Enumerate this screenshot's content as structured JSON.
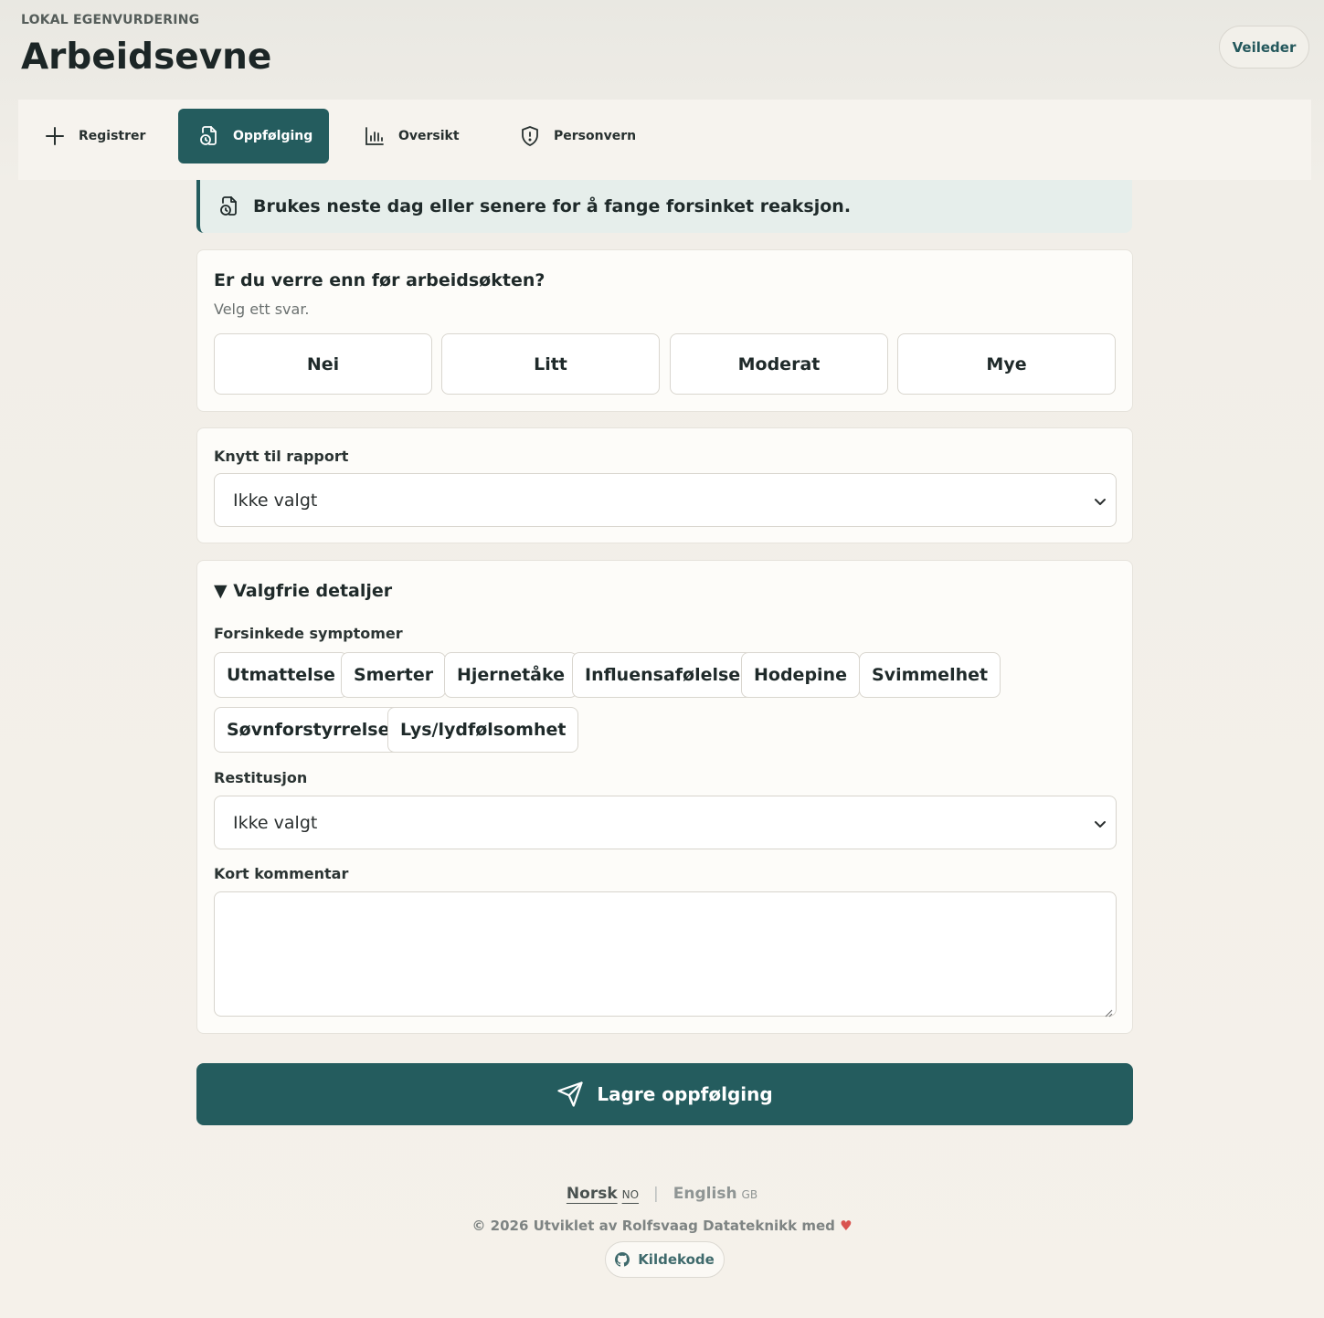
{
  "header": {
    "eyebrow": "LOKAL EGENVURDERING",
    "title": "Arbeidsevne",
    "role_button": "Veileder"
  },
  "tabs": [
    {
      "label": "Registrer",
      "icon": "plus-icon",
      "active": false
    },
    {
      "label": "Oppfølging",
      "icon": "clock-document-icon",
      "active": true
    },
    {
      "label": "Oversikt",
      "icon": "bar-chart-icon",
      "active": false
    },
    {
      "label": "Personvern",
      "icon": "shield-icon",
      "active": false
    }
  ],
  "info_banner": {
    "icon": "clock-document-icon",
    "text": "Brukes neste dag eller senere for å fange forsinket reaksjon."
  },
  "question": {
    "title": "Er du verre enn før arbeidsøkten?",
    "hint": "Velg ett svar.",
    "options": [
      "Nei",
      "Litt",
      "Moderat",
      "Mye"
    ]
  },
  "report_link": {
    "label": "Knytt til rapport",
    "selected": "Ikke valgt"
  },
  "details": {
    "summary": "▼ Valgfrie detaljer",
    "symptoms_label": "Forsinkede symptomer",
    "symptoms": [
      "Utmattelse",
      "Smerter",
      "Hjernetåke",
      "Influensafølelse",
      "Hodepine",
      "Svimmelhet",
      "Søvnforstyrrelse",
      "Lys/lydfølsomhet"
    ],
    "restitution_label": "Restitusjon",
    "restitution_selected": "Ikke valgt",
    "comment_label": "Kort kommentar",
    "comment_value": ""
  },
  "submit": {
    "label": "Lagre oppfølging",
    "icon": "send-icon"
  },
  "footer": {
    "lang_no": "Norsk",
    "lang_no_code": "NO",
    "separator": "|",
    "lang_en": "English",
    "lang_en_code": "GB",
    "copyright": "© 2026 Utviklet av Rolfsvaag Datateknikk med",
    "heart": "♥",
    "source_button": "Kildekode",
    "source_icon": "github-icon"
  },
  "colors": {
    "accent": "#245c5e",
    "background": "#f5f1ea",
    "card": "#fdfcf9",
    "heart": "#d9534f"
  }
}
